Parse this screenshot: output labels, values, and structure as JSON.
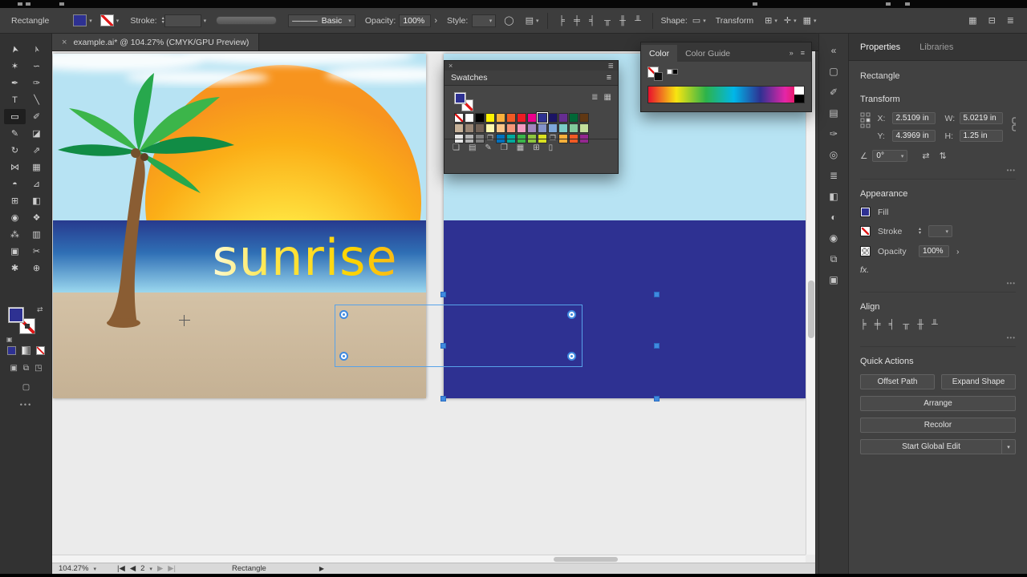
{
  "glyphs": {
    "chevron_down": "▾",
    "chevron_up": "▴",
    "menu": "≡",
    "panel_menu": "≣",
    "double_right": "»",
    "more": "•••",
    "arrow_right": "›",
    "close": "×",
    "circle": "◯",
    "play": "▶",
    "dash_preview": "———",
    "grid": "▦",
    "boxminus": "⊟",
    "boxplus": "⊞",
    "doc": "▤",
    "rect": "▭",
    "cross": "✛"
  },
  "colors": {
    "accent_blue": "#2e3192",
    "sky": "#b7e3f3",
    "sun_outer": "#f7941e",
    "sea_top": "#273a8e",
    "sea_bottom": "#9bd7ee",
    "sand": "#cdb99c",
    "palm_green": "#3cb54a",
    "trunk": "#8a5d33",
    "selection": "#3f8ae0",
    "headline_yellow": "#ffd400"
  },
  "control_bar": {
    "selection_label": "Rectangle",
    "stroke_label": "Stroke:",
    "brush_value": "Basic",
    "opacity_label": "Opacity:",
    "opacity_value": "100%",
    "style_label": "Style:",
    "shape_label": "Shape:",
    "transform_label": "Transform",
    "align_icons": [
      {
        "name": "align-horizontal-left",
        "glyph": "╞"
      },
      {
        "name": "align-horizontal-center",
        "glyph": "╪"
      },
      {
        "name": "align-horizontal-right",
        "glyph": "╡"
      },
      {
        "name": "align-vertical-top",
        "glyph": "╥"
      },
      {
        "name": "align-vertical-center",
        "glyph": "╫"
      },
      {
        "name": "align-vertical-bottom",
        "glyph": "╨"
      }
    ]
  },
  "document_tab": {
    "close_label": "×",
    "title": "example.ai* @ 104.27% (CMYK/GPU Preview)"
  },
  "toolbar": {
    "tools": [
      {
        "name": "selection",
        "glyph": "➤",
        "rotate": true
      },
      {
        "name": "direct-selection",
        "glyph": "➢",
        "rotate": true
      },
      {
        "name": "magic-wand",
        "glyph": "✶"
      },
      {
        "name": "lasso",
        "glyph": "∽"
      },
      {
        "name": "pen",
        "glyph": "✒"
      },
      {
        "name": "curvature",
        "glyph": "✑"
      },
      {
        "name": "type",
        "glyph": "T"
      },
      {
        "name": "line-segment",
        "glyph": "╲"
      },
      {
        "name": "rectangle",
        "glyph": "▭",
        "active": true
      },
      {
        "name": "paintbrush",
        "glyph": "✐"
      },
      {
        "name": "pencil",
        "glyph": "✎"
      },
      {
        "name": "eraser",
        "glyph": "◪"
      },
      {
        "name": "rotate",
        "glyph": "↻"
      },
      {
        "name": "scale",
        "glyph": "⇗"
      },
      {
        "name": "width",
        "glyph": "⋈"
      },
      {
        "name": "free-transform",
        "glyph": "▦"
      },
      {
        "name": "shape-builder",
        "glyph": "◓"
      },
      {
        "name": "perspective-grid",
        "glyph": "⊿"
      },
      {
        "name": "mesh",
        "glyph": "⊞"
      },
      {
        "name": "gradient",
        "glyph": "◧"
      },
      {
        "name": "eyedropper",
        "glyph": "◉"
      },
      {
        "name": "blend",
        "glyph": "❖"
      },
      {
        "name": "symbol-sprayer",
        "glyph": "⁂"
      },
      {
        "name": "column-graph",
        "glyph": "▥"
      },
      {
        "name": "artboard",
        "glyph": "▣"
      },
      {
        "name": "slice",
        "glyph": "✂"
      },
      {
        "name": "hand",
        "glyph": "✱"
      },
      {
        "name": "zoom",
        "glyph": "⊕"
      }
    ]
  },
  "artwork": {
    "headline": "sunrise"
  },
  "swatches_panel": {
    "title": "Swatches",
    "rows": [
      [
        {
          "type": "none"
        },
        {
          "type": "color",
          "value": "#ffffff"
        },
        {
          "type": "color",
          "value": "#000000"
        },
        {
          "type": "color",
          "value": "#fff200"
        },
        {
          "type": "color",
          "value": "#fbb03b"
        },
        {
          "type": "color",
          "value": "#f15a24"
        },
        {
          "type": "color",
          "value": "#ed1c24"
        },
        {
          "type": "color",
          "value": "#ec008c"
        },
        {
          "type": "color",
          "value": "#2e3192",
          "selected": true
        },
        {
          "type": "color",
          "value": "#1b1464"
        },
        {
          "type": "color",
          "value": "#662d91"
        },
        {
          "type": "color",
          "value": "#006837"
        },
        {
          "type": "color",
          "value": "#603813"
        }
      ],
      [
        {
          "type": "color",
          "value": "#c7b299"
        },
        {
          "type": "color",
          "value": "#998675"
        },
        {
          "type": "color",
          "value": "#736357"
        },
        {
          "type": "color",
          "value": "#fff9ae"
        },
        {
          "type": "color",
          "value": "#fdc689"
        },
        {
          "type": "color",
          "value": "#f69679"
        },
        {
          "type": "color",
          "value": "#f49ac1"
        },
        {
          "type": "color",
          "value": "#a186be"
        },
        {
          "type": "color",
          "value": "#8393ca"
        },
        {
          "type": "color",
          "value": "#7da7d9"
        },
        {
          "type": "color",
          "value": "#7accc8"
        },
        {
          "type": "color",
          "value": "#82ca9c"
        },
        {
          "type": "color",
          "value": "#c4df9b"
        }
      ],
      [
        {
          "type": "color",
          "value": "#e6e6e6"
        },
        {
          "type": "color",
          "value": "#b3b3b3"
        },
        {
          "type": "color",
          "value": "#808080"
        },
        {
          "type": "folder",
          "glyph": "❐"
        },
        {
          "type": "color",
          "value": "#0071bc"
        },
        {
          "type": "color",
          "value": "#00a99d"
        },
        {
          "type": "color",
          "value": "#39b54a"
        },
        {
          "type": "color",
          "value": "#8dc63f"
        },
        {
          "type": "color",
          "value": "#d9e021"
        },
        {
          "type": "folder",
          "glyph": "❐"
        },
        {
          "type": "color",
          "value": "#fbb03b"
        },
        {
          "type": "color",
          "value": "#f15a24"
        },
        {
          "type": "color",
          "value": "#93278f"
        }
      ]
    ],
    "footer_icons": [
      {
        "name": "swatch-libraries",
        "glyph": "❏"
      },
      {
        "name": "swatch-kinds",
        "glyph": "▤"
      },
      {
        "name": "swatch-options",
        "glyph": "✎"
      },
      {
        "name": "new-color-group",
        "glyph": "❐"
      },
      {
        "name": "swatch-view",
        "glyph": "▦"
      },
      {
        "name": "new-swatch",
        "glyph": "⊞"
      },
      {
        "name": "delete-swatch",
        "glyph": "▯"
      }
    ]
  },
  "color_panel": {
    "tab_color": "Color",
    "tab_color_guide": "Color Guide"
  },
  "dock": {
    "icons": [
      {
        "name": "expand-panels",
        "glyph": "«"
      },
      {
        "name": "color",
        "glyph": "▢"
      },
      {
        "name": "color-guide",
        "glyph": "✐"
      },
      {
        "name": "swatches",
        "glyph": "▤"
      },
      {
        "name": "brushes",
        "glyph": "✑"
      },
      {
        "name": "symbols",
        "glyph": "◎"
      },
      {
        "name": "stroke",
        "glyph": "≣"
      },
      {
        "name": "gradient",
        "glyph": "◧"
      },
      {
        "name": "transparency",
        "glyph": "◐"
      },
      {
        "name": "appearance",
        "glyph": "◉"
      },
      {
        "name": "layers",
        "glyph": "⧉"
      },
      {
        "name": "artboards",
        "glyph": "▣"
      }
    ]
  },
  "properties_panel": {
    "tab_properties": "Properties",
    "tab_libraries": "Libraries",
    "object_type": "Rectangle",
    "transform": {
      "title": "Transform",
      "x_label": "X:",
      "x_value": "2.5109 in",
      "y_label": "Y:",
      "y_value": "4.3969 in",
      "w_label": "W:",
      "w_value": "5.0219 in",
      "h_label": "H:",
      "h_value": "1.25 in",
      "angle_value": "0°"
    },
    "appearance": {
      "title": "Appearance",
      "fill_label": "Fill",
      "stroke_label": "Stroke",
      "opacity_label": "Opacity",
      "opacity_value": "100%",
      "fx_label": "fx."
    },
    "align": {
      "title": "Align",
      "icons": [
        {
          "name": "align-horizontal-left",
          "glyph": "╞"
        },
        {
          "name": "align-horizontal-center",
          "glyph": "╪"
        },
        {
          "name": "align-horizontal-right",
          "glyph": "╡"
        },
        {
          "name": "align-vertical-top",
          "glyph": "╥"
        },
        {
          "name": "align-vertical-center",
          "glyph": "╫"
        },
        {
          "name": "align-vertical-bottom",
          "glyph": "╨"
        }
      ]
    },
    "quick_actions": {
      "title": "Quick Actions",
      "offset_path": "Offset Path",
      "expand_shape": "Expand Shape",
      "arrange": "Arrange",
      "recolor": "Recolor",
      "start_global_edit": "Start Global Edit"
    }
  },
  "status_bar": {
    "zoom": "104.27%",
    "artboard_number": "2",
    "tool_label": "Rectangle",
    "nav_first": "|◀",
    "nav_prev": "◀",
    "nav_next": "▶",
    "nav_last": "▶|"
  }
}
